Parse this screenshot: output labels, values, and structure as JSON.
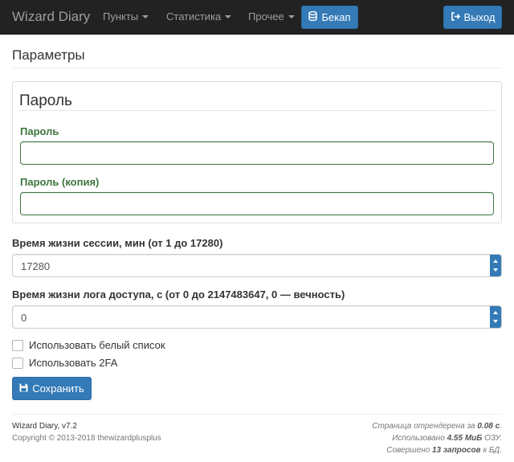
{
  "navbar": {
    "brand": "Wizard Diary",
    "items": [
      {
        "label": "Пункты"
      },
      {
        "label": "Статистика"
      },
      {
        "label": "Прочее"
      }
    ],
    "backup_label": "Бекап",
    "logout_label": "Выход"
  },
  "page": {
    "title": "Параметры"
  },
  "password_panel": {
    "legend": "Пароль",
    "password_label": "Пароль",
    "password_value": "",
    "password_copy_label": "Пароль (копия)",
    "password_copy_value": ""
  },
  "session": {
    "label": "Время жизни сессии, мин (от 1 до 17280)",
    "value": "17280"
  },
  "access_log": {
    "label": "Время жизни лога доступа, с (от 0 до 2147483647, 0 — вечность)",
    "value": "0"
  },
  "checkboxes": {
    "whitelist_label": "Использовать белый список",
    "whitelist_checked": false,
    "twofa_label": "Использовать 2FA",
    "twofa_checked": false
  },
  "save_label": "Сохранить",
  "footer": {
    "version": "Wizard Diary, v7.2",
    "copyright": "Copyright © 2013-2018 thewizardplusplus",
    "render_prefix": "Страница отрендерена за ",
    "render_value": "0.08 с",
    "render_suffix": ".",
    "memory_prefix": "Использовано ",
    "memory_value": "4.55 МиБ",
    "memory_suffix": " ОЗУ.",
    "queries_prefix": "Совершено ",
    "queries_value": "13 запросов",
    "queries_suffix": " к БД."
  },
  "colors": {
    "navbar_bg": "#222222",
    "primary": "#337ab7",
    "success_green": "#3c763d"
  },
  "icons": {
    "backup": "database-icon",
    "logout": "sign-out-icon",
    "save": "floppy-disk-icon"
  }
}
